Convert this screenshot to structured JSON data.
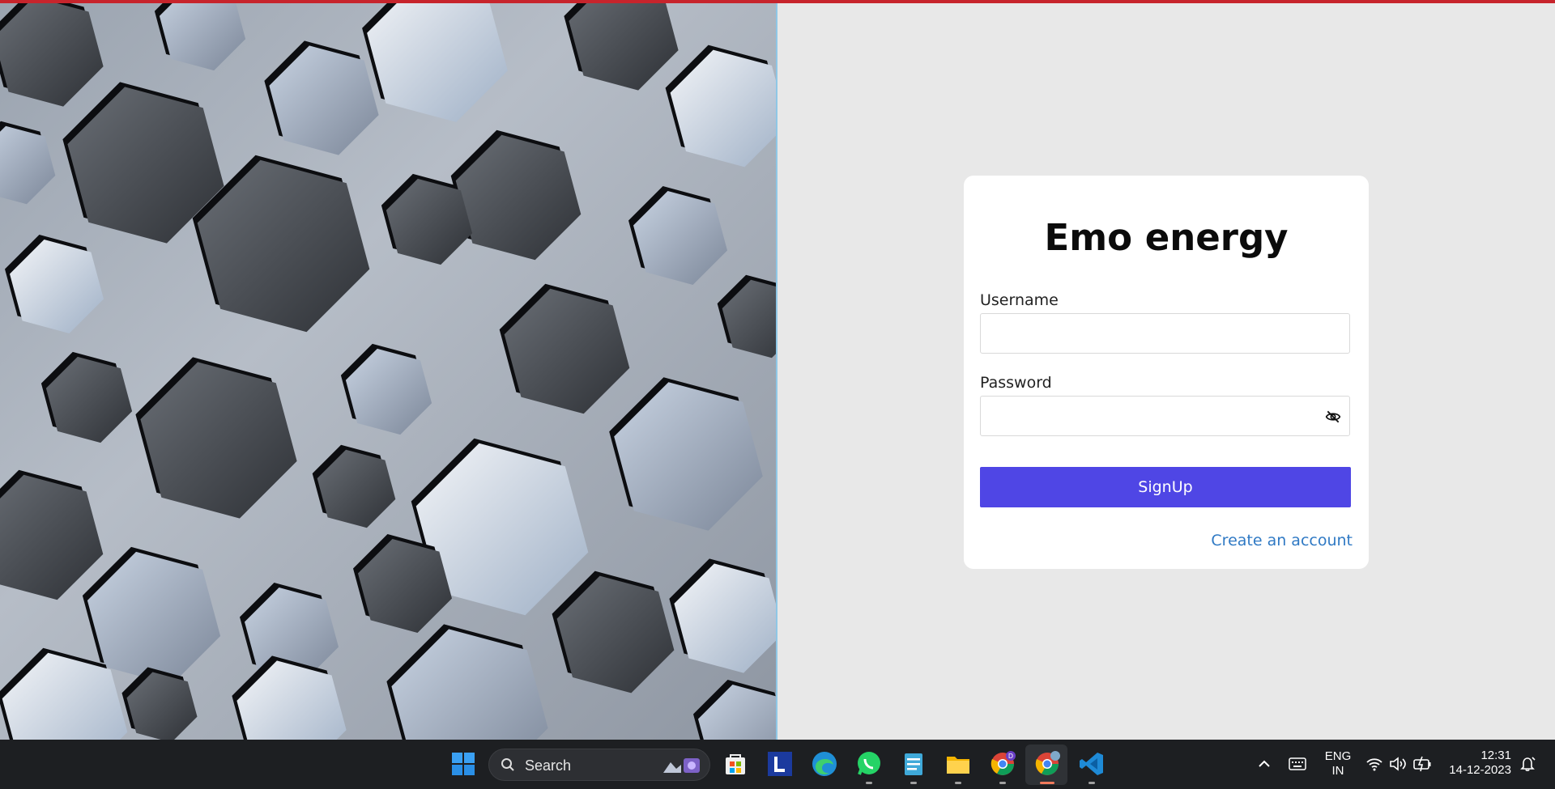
{
  "app": {
    "title": "Emo energy"
  },
  "form": {
    "username_label": "Username",
    "username_value": "",
    "password_label": "Password",
    "password_value": "",
    "submit_label": "SignUp",
    "create_account_link": "Create an account"
  },
  "taskbar": {
    "search_label": "Search",
    "apps": [
      "start-icon",
      "store-icon",
      "l-app-icon",
      "edge-icon",
      "whatsapp-icon",
      "notepad-icon",
      "file-explorer-icon",
      "chrome-profile-icon",
      "chrome-icon",
      "vscode-icon"
    ],
    "language_line1": "ENG",
    "language_line2": "IN",
    "time": "12:31",
    "date": "14-12-2023",
    "chrome_badge": "D"
  },
  "colors": {
    "accent": "#4f46e5",
    "link": "#2f79c4",
    "background": "#e8e8e8",
    "taskbar": "#1d1f22",
    "top_strip": "#c7242c"
  }
}
